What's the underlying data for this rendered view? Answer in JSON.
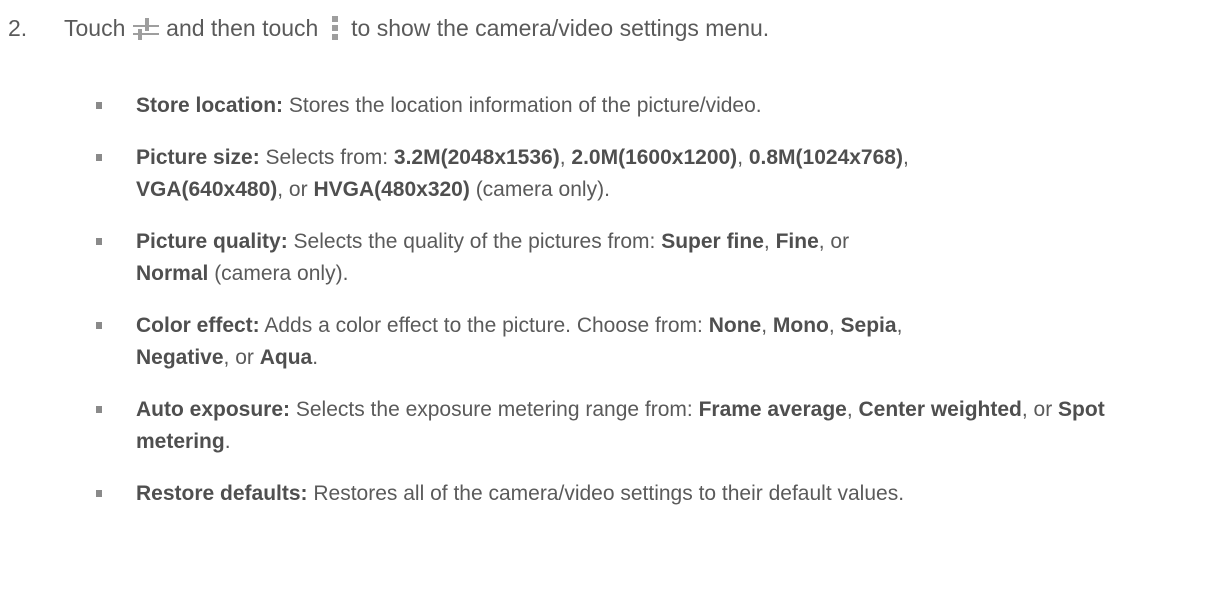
{
  "step": {
    "number": "2.",
    "before_icon1": "Touch",
    "icon1": "settings-sliders-icon",
    "between_icons": "and then touch",
    "icon2": "vertical-menu-icon",
    "after_icon2": "to show the camera/video settings menu."
  },
  "colors": {
    "text": "#5a5a5a",
    "bullet": "#8a8a8a",
    "icon": "#9e9e9e"
  },
  "items": [
    {
      "term": "Store location:",
      "text": " Stores the location information of the picture/video."
    },
    {
      "term": "Picture size:",
      "t0": " Selects from: ",
      "o1": "3.2M(2048x1536)",
      "s1": ", ",
      "o2": "2.0M(1600x1200)",
      "s2": ", ",
      "o3": "0.8M(1024x768)",
      "s3": ", ",
      "o4": "VGA(640x480)",
      "s4": ", or ",
      "o5": "HVGA(480x320)",
      "tail": " (camera only)."
    },
    {
      "term": "Picture quality:",
      "t0": " Selects the quality of the pictures from: ",
      "o1": "Super fine",
      "s1": ", ",
      "o2": "Fine",
      "s2": ", or ",
      "o3": "Normal",
      "tail": " (camera only)."
    },
    {
      "term": "Color effect:",
      "t0": " Adds a color effect to the picture. Choose from: ",
      "o1": "None",
      "s1": ", ",
      "o2": "Mono",
      "s2": ", ",
      "o3": "Sepia",
      "s3": ", ",
      "o4": "Negative",
      "s4": ", or ",
      "o5": "Aqua",
      "tail": "."
    },
    {
      "term": "Auto exposure:",
      "t0": " Selects the exposure metering range from: ",
      "o1": "Frame average",
      "s1": ", ",
      "o2": "Center weighted",
      "s2": ", or ",
      "o3": "Spot metering",
      "tail": "."
    },
    {
      "term": "Restore defaults:",
      "text": " Restores all of the camera/video settings to their default values."
    }
  ]
}
